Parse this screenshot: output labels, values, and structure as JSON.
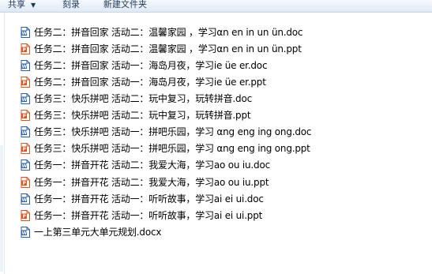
{
  "toolbar": {
    "share_label": "共享",
    "burn_label": "刻录",
    "new_folder_label": "新建文件夹"
  },
  "colors": {
    "doc_icon": "#2b5ea8",
    "ppt_icon": "#d9541e"
  },
  "files": [
    {
      "name": "任务二：拼音回家 活动二：温馨家园 ，学习αn en in un ün.doc",
      "icon": "word-doc-icon"
    },
    {
      "name": "任务二：拼音回家 活动二：温馨家园 ，学习αn en in un ün.ppt",
      "icon": "powerpoint-icon"
    },
    {
      "name": "任务二：拼音回家 活动一：海岛月夜，学习ie üe er.doc",
      "icon": "word-doc-icon"
    },
    {
      "name": "任务二：拼音回家 活动一：海岛月夜，学习ie üe er.ppt",
      "icon": "powerpoint-icon"
    },
    {
      "name": "任务三：快乐拼吧 活动二：玩中复习，玩转拼音.doc",
      "icon": "word-doc-icon"
    },
    {
      "name": "任务三：快乐拼吧 活动二：玩中复习，玩转拼音.ppt",
      "icon": "powerpoint-icon"
    },
    {
      "name": "任务三：快乐拼吧 活动一：拼吧乐园，学习 αng eng ing ong.doc",
      "icon": "word-doc-icon"
    },
    {
      "name": "任务三：快乐拼吧 活动一：拼吧乐园，学习 αng eng ing ong.ppt",
      "icon": "powerpoint-icon"
    },
    {
      "name": "任务一：拼音开花 活动二：我爱大海，学习ao ou iu.doc",
      "icon": "word-doc-icon"
    },
    {
      "name": "任务一：拼音开花 活动二：我爱大海，学习ao ou iu.ppt",
      "icon": "powerpoint-icon"
    },
    {
      "name": "任务一：拼音开花 活动一：听听故事，学习ai ei ui.doc",
      "icon": "word-doc-icon"
    },
    {
      "name": "任务一：拼音开花 活动一：听听故事，学习ai ei ui.ppt",
      "icon": "powerpoint-icon"
    },
    {
      "name": "一上第三单元大单元规划.docx",
      "icon": "word-docx-icon"
    }
  ]
}
